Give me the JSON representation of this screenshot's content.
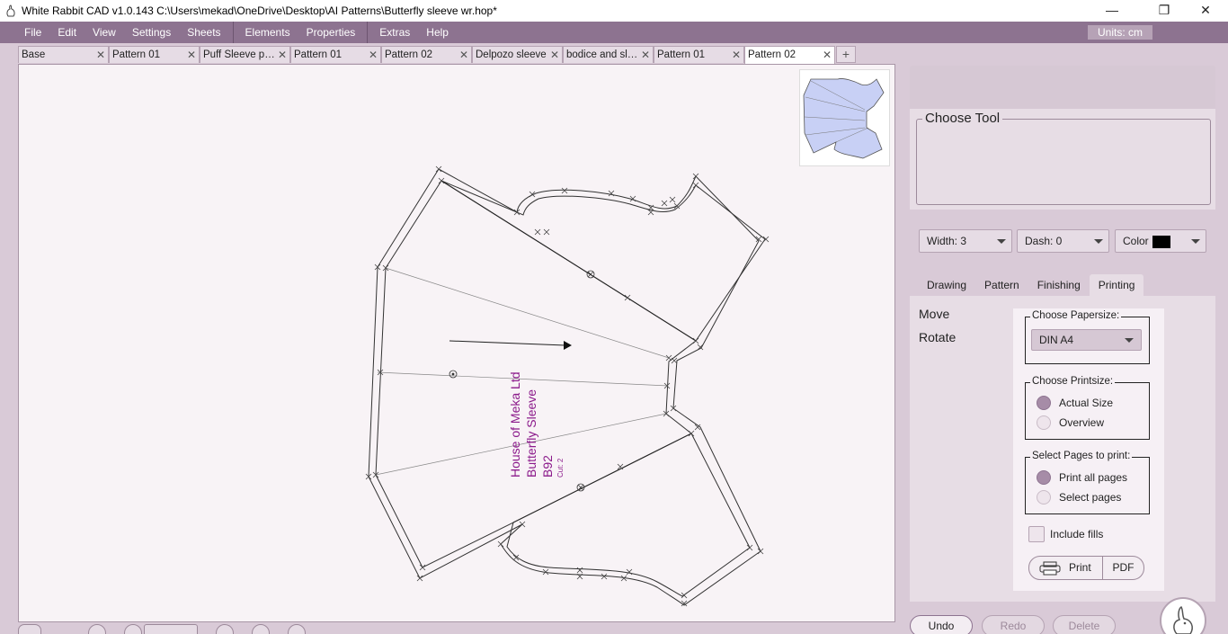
{
  "window": {
    "title": "White Rabbit CAD v1.0.143   C:\\Users\\mekad\\OneDrive\\Desktop\\AI Patterns\\Butterfly sleeve wr.hop*",
    "controls": {
      "minimize": "—",
      "restore": "❐",
      "close": "✕"
    }
  },
  "menubar": {
    "items": [
      "File",
      "Edit",
      "View",
      "Settings",
      "Sheets"
    ],
    "items2": [
      "Elements",
      "Properties"
    ],
    "items3": [
      "Extras",
      "Help"
    ],
    "units": "Units:  cm"
  },
  "tabs": [
    {
      "label": "Base",
      "active": false
    },
    {
      "label": "Pattern 01",
      "active": false
    },
    {
      "label": "Puff Sleeve pa...",
      "active": false
    },
    {
      "label": "Pattern 01",
      "active": false
    },
    {
      "label": "Pattern 02",
      "active": false
    },
    {
      "label": "Delpozo sleeve",
      "active": false
    },
    {
      "label": "bodice and sle...",
      "active": false
    },
    {
      "label": "Pattern 01",
      "active": false
    },
    {
      "label": "Pattern 02",
      "active": true
    }
  ],
  "tab_close": "✕",
  "tab_add": "+",
  "canvas": {
    "label_line1": "House of Meka Ltd",
    "label_line2": "Butterfly Sleeve",
    "label_line3": "B92",
    "label_line4": "Cut: 2"
  },
  "tool": {
    "title": "Choose Tool"
  },
  "line_props": {
    "width": "Width:  3",
    "dash": "Dash: 0",
    "color": "Color"
  },
  "panel_tabs": [
    "Drawing",
    "Pattern",
    "Finishing",
    "Printing"
  ],
  "actions": [
    "Move",
    "Rotate"
  ],
  "printing": {
    "papersize_title": "Choose Papersize:",
    "papersize_value": "DIN A4",
    "printsize_title": "Choose Printsize:",
    "printsize_options": [
      {
        "label": "Actual Size",
        "selected": true
      },
      {
        "label": "Overview",
        "selected": false
      }
    ],
    "pages_title": "Select Pages to print:",
    "pages_options": [
      {
        "label": "Print all pages",
        "selected": true
      },
      {
        "label": "Select pages",
        "selected": false
      }
    ],
    "include_fills": "Include fills",
    "print_button": "Print",
    "pdf_button": "PDF"
  },
  "bottom": {
    "undo": "Undo",
    "redo": "Redo",
    "delete": "Delete"
  },
  "colors": {
    "menubar": "#8d7390",
    "canvas_bg": "#f8f3f6",
    "pattern_fill_preview": "#c8d0f5",
    "label_text": "#8b1a8b"
  }
}
